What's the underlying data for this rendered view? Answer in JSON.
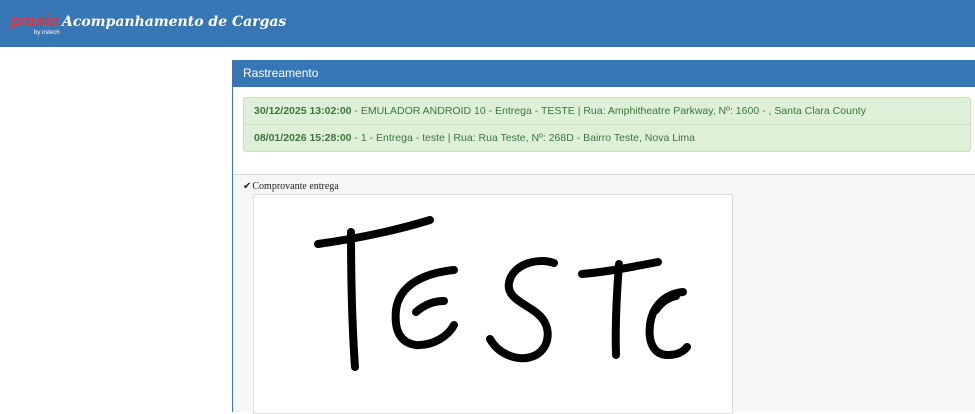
{
  "header": {
    "logo_text": "praxio",
    "logo_subtext": "by nstech",
    "title": "Acompanhamento de Cargas"
  },
  "panel": {
    "title": "Rastreamento",
    "events": [
      {
        "datetime": "30/12/2025 13:02:00",
        "description": " - EMULADOR ANDROID 10 - Entrega - TESTE | Rua: Amphitheatre Parkway, Nº: 1600 - , Santa Clara County"
      },
      {
        "datetime": "08/01/2026 15:28:00",
        "description": " - 1 - Entrega - teste | Rua: Rua Teste, Nº: 268D - Bairro Teste, Nova Lima"
      }
    ],
    "receipt_label": "Comprovante entrega",
    "signature_text": "TESTE"
  },
  "colors": {
    "primary": "#3777b5",
    "alert_bg": "#dff0d8",
    "alert_text": "#3c763d",
    "logo_red": "#e8303a"
  }
}
